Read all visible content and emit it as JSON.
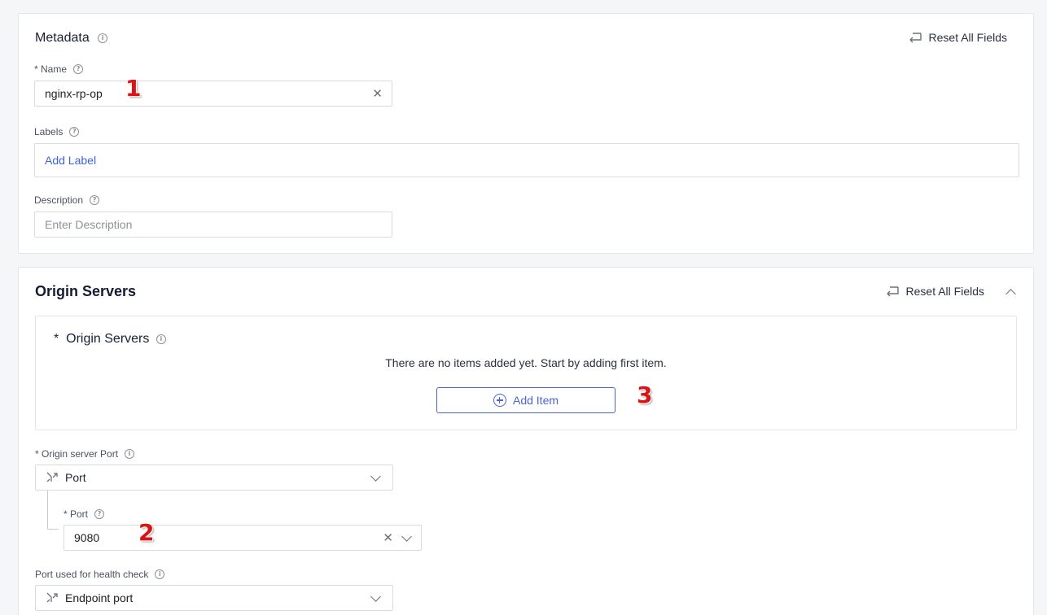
{
  "metadata": {
    "title": "Metadata",
    "reset_label": "Reset All Fields",
    "name": {
      "label": "* Name",
      "value": "nginx-rp-op"
    },
    "labels": {
      "label": "Labels",
      "add_label": "Add Label"
    },
    "description": {
      "label": "Description",
      "placeholder": "Enter Description"
    }
  },
  "origin": {
    "title": "Origin Servers",
    "reset_label": "Reset All Fields",
    "list": {
      "title": "*  Origin Servers",
      "empty_text": "There are no items added yet. Start by adding first item.",
      "add_item": "Add Item"
    },
    "port_type": {
      "label": "* Origin server Port",
      "value": "Port"
    },
    "port": {
      "label": "* Port",
      "value": "9080"
    },
    "health": {
      "label": "Port used for health check",
      "value": "Endpoint port"
    }
  },
  "annotations": [
    "1",
    "2",
    "3"
  ],
  "colors": {
    "accent": "#3f63d8",
    "annotation": "#d81414"
  }
}
